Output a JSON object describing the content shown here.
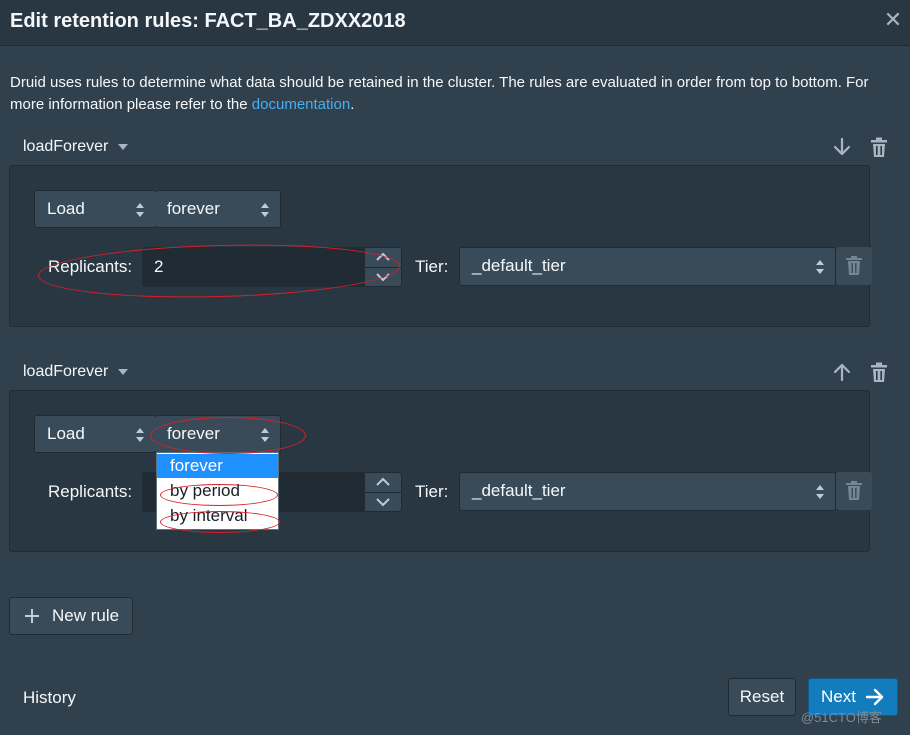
{
  "dialog": {
    "title": "Edit retention rules: FACT_BA_ZDXX2018",
    "close_icon": "close-icon",
    "description": "Druid uses rules to determine what data should be retained in the cluster. The rules are evaluated in order from top to bottom. For more information please refer to the ",
    "description_link": "documentation",
    "description_end": "."
  },
  "rules": [
    {
      "name": "loadForever",
      "move_icon": "arrow-down-icon",
      "delete_icon": "trash-icon",
      "action": "Load",
      "period": "forever",
      "replicants_label": "Replicants:",
      "replicants_value": "2",
      "tier_label": "Tier:",
      "tier_value": "_default_tier"
    },
    {
      "name": "loadForever",
      "move_icon": "arrow-up-icon",
      "delete_icon": "trash-icon",
      "action": "Load",
      "period": "forever",
      "replicants_label": "Replicants:",
      "replicants_value": "",
      "tier_label": "Tier:",
      "tier_value": "_default_tier",
      "period_options": [
        "forever",
        "by period",
        "by interval"
      ],
      "period_selected": "forever"
    }
  ],
  "buttons": {
    "new_rule": "New rule",
    "history": "History",
    "reset": "Reset",
    "next": "Next"
  },
  "watermark": "@51CTO博客",
  "colors": {
    "background": "#30404d",
    "panel": "#293742",
    "link": "#48aff0",
    "primary": "#137cbd",
    "selected_option": "#1e90ff",
    "annotation": "#d8202a"
  }
}
